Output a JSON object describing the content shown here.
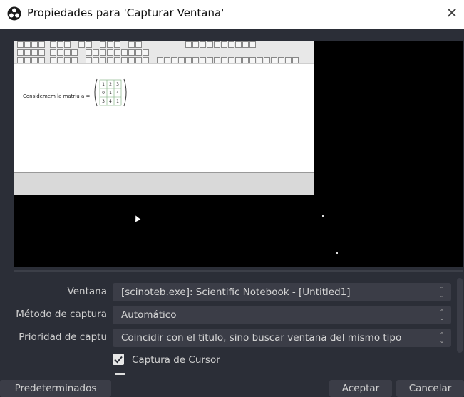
{
  "window": {
    "title": "Propiedades para 'Capturar Ventana'",
    "close_glyph": "✕"
  },
  "preview": {
    "document_text": "Considemem la matriu",
    "matrix_var": "a =",
    "matrix_rows": [
      [
        "1",
        "2",
        "3"
      ],
      [
        "0",
        "1",
        "4"
      ],
      [
        "3",
        "4",
        "1"
      ]
    ]
  },
  "fields": [
    {
      "label": "Ventana",
      "value": "[scinoteb.exe]: Scientific Notebook - [Untitled1]"
    },
    {
      "label": "Método de captura",
      "value": "Automático"
    },
    {
      "label": "Prioridad de captu",
      "value": "Coincidir con el titulo, sino buscar ventana del mismo tipo"
    }
  ],
  "cursor_capture": {
    "label": "Captura de Cursor",
    "checked": true
  },
  "buttons": {
    "defaults": "Predeterminados",
    "accept": "Aceptar",
    "cancel": "Cancelar"
  },
  "icons": {
    "app": "obs-logo-icon",
    "close": "close-icon",
    "spin": "spin-arrows-icon",
    "check": "checkmark-icon"
  },
  "colors": {
    "background": "#2b2e37",
    "field": "#3b3d47",
    "text": "#d0d0d0"
  }
}
